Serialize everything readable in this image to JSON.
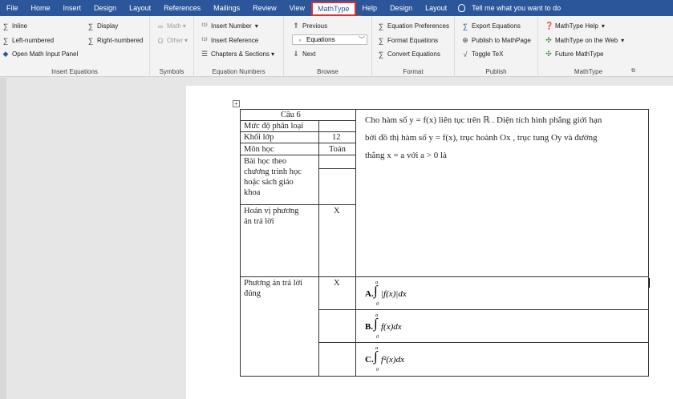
{
  "tabs": [
    "File",
    "Home",
    "Insert",
    "Design",
    "Layout",
    "References",
    "Mailings",
    "Review",
    "View",
    "MathType",
    "Help",
    "Design",
    "Layout"
  ],
  "active_tab": "MathType",
  "tell_me": "Tell me what you want to do",
  "badge": "1",
  "ribbon": {
    "insert_equations": {
      "inline": "Inline",
      "display": "Display",
      "left_numbered": "Left-numbered",
      "right_numbered": "Right-numbered",
      "open_panel": "Open Math Input Panel",
      "label": "Insert Equations"
    },
    "symbols": {
      "math": "Math",
      "other": "Other",
      "label": "Symbols"
    },
    "equation_numbers": {
      "insert_number": "Insert Number",
      "insert_reference": "Insert Reference",
      "chapters": "Chapters & Sections",
      "label": "Equation Numbers"
    },
    "browse": {
      "previous": "Previous",
      "equations": "Equations",
      "next": "Next",
      "label": "Browse"
    },
    "format": {
      "prefs": "Equation Preferences",
      "format_eq": "Format Equations",
      "convert": "Convert Equations",
      "label": "Format"
    },
    "publish": {
      "export": "Export Equations",
      "publish_mathpage": "Publish to MathPage",
      "toggle_tex": "Toggle TeX",
      "label": "Publish"
    },
    "mathtype": {
      "help": "MathType Help",
      "web": "MathType on the Web",
      "future": "Future MathType",
      "label": "MathType"
    }
  },
  "document": {
    "question_no": "Câu 6",
    "difficulty_label": "Mức độ phân loại",
    "grade_label": "Khối lớp",
    "grade_value": "12",
    "subject_label": "Môn học",
    "subject_value": "Toán",
    "lesson_label_lines": [
      "Bài học theo",
      "chương trình học",
      "hoặc sách giáo",
      "khoa"
    ],
    "shuffle_label_lines": [
      "Hoán vị phương",
      "án trả lời"
    ],
    "shuffle_value": "X",
    "correct_label_lines": [
      "Phương án trả lời",
      "đúng"
    ],
    "correct_value": "X",
    "question_text_lines": [
      "Cho hàm số y = f(x) liên tục trên ℝ . Diện tích hình phẳng giới hạn",
      "bởi đồ thị hàm số y = f(x), trục hoành Ox , trục tung Oy và đường",
      "thẳng x = a với a > 0 là"
    ],
    "options": [
      {
        "label": "A.",
        "integrand": "|f(x)|dx",
        "upper": "a",
        "lower": "0"
      },
      {
        "label": "B.",
        "integrand": "f(x)dx",
        "upper": "a",
        "lower": "0"
      },
      {
        "label": "C.",
        "integrand": "f²(x)dx",
        "upper": "a",
        "lower": "0"
      }
    ]
  }
}
